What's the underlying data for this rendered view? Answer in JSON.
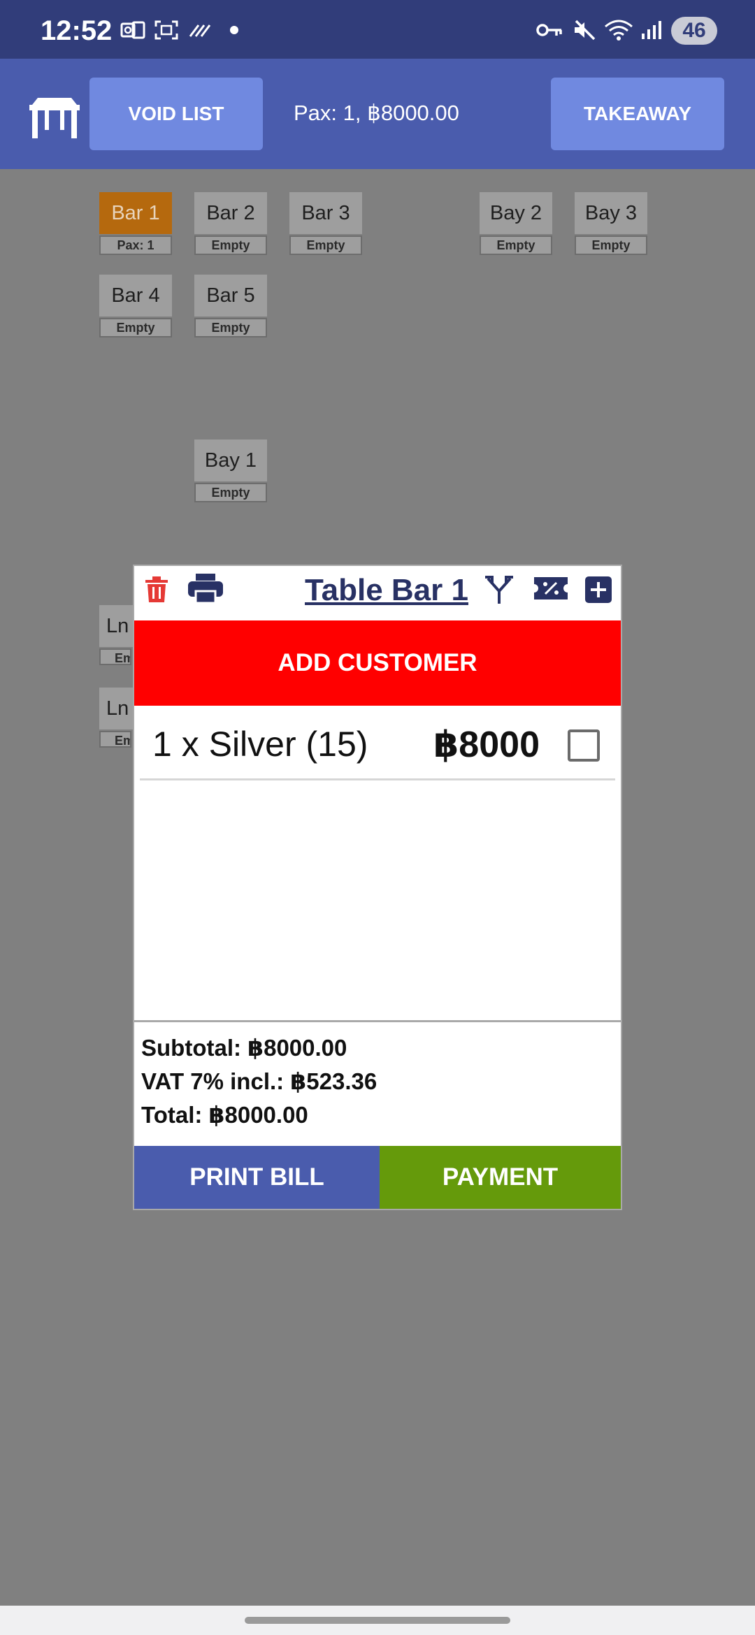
{
  "status_bar": {
    "time": "12:52",
    "battery": "46",
    "icons": [
      "outlook-icon",
      "screenshot-icon",
      "data-saver-icon",
      "dot-icon",
      "vpn-key-icon",
      "mute-icon",
      "wifi-icon",
      "signal-icon"
    ]
  },
  "top_bar": {
    "table_icon": "table-icon",
    "void_list_label": "VOID LIST",
    "pax_summary": "Pax: 1, ฿8000.00",
    "takeaway_label": "TAKEAWAY",
    "accent": "#4a5cad",
    "button_color": "#7089e0"
  },
  "tables": [
    {
      "name": "Bar 1",
      "status": "Pax: 1",
      "active": true
    },
    {
      "name": "Bar 2",
      "status": "Empty"
    },
    {
      "name": "Bar 3",
      "status": "Empty"
    },
    {
      "name": "Bay 2",
      "status": "Empty"
    },
    {
      "name": "Bay 3",
      "status": "Empty"
    },
    {
      "name": "Bar 4",
      "status": "Empty"
    },
    {
      "name": "Bar 5",
      "status": "Empty"
    },
    {
      "name": "Bay 1",
      "status": "Empty"
    },
    {
      "name": "Ln",
      "status": "Em"
    },
    {
      "name": "Ln",
      "status": "Em"
    }
  ],
  "dialog": {
    "title": "Table Bar 1",
    "header_icons": [
      "delete-icon",
      "print-icon",
      "split-icon",
      "discount-icon",
      "add-icon"
    ],
    "add_customer_label": "ADD CUSTOMER",
    "items": [
      {
        "name": "1 x Silver (15)",
        "price": "฿8000",
        "checked": false
      }
    ],
    "subtotal": "Subtotal: ฿8000.00",
    "vat": "VAT 7% incl.: ฿523.36",
    "total": "Total: ฿8000.00",
    "print_bill_label": "PRINT BILL",
    "payment_label": "PAYMENT",
    "colors": {
      "add_customer": "#ff0000",
      "print_bill": "#4a5cad",
      "payment": "#659a0b"
    }
  }
}
